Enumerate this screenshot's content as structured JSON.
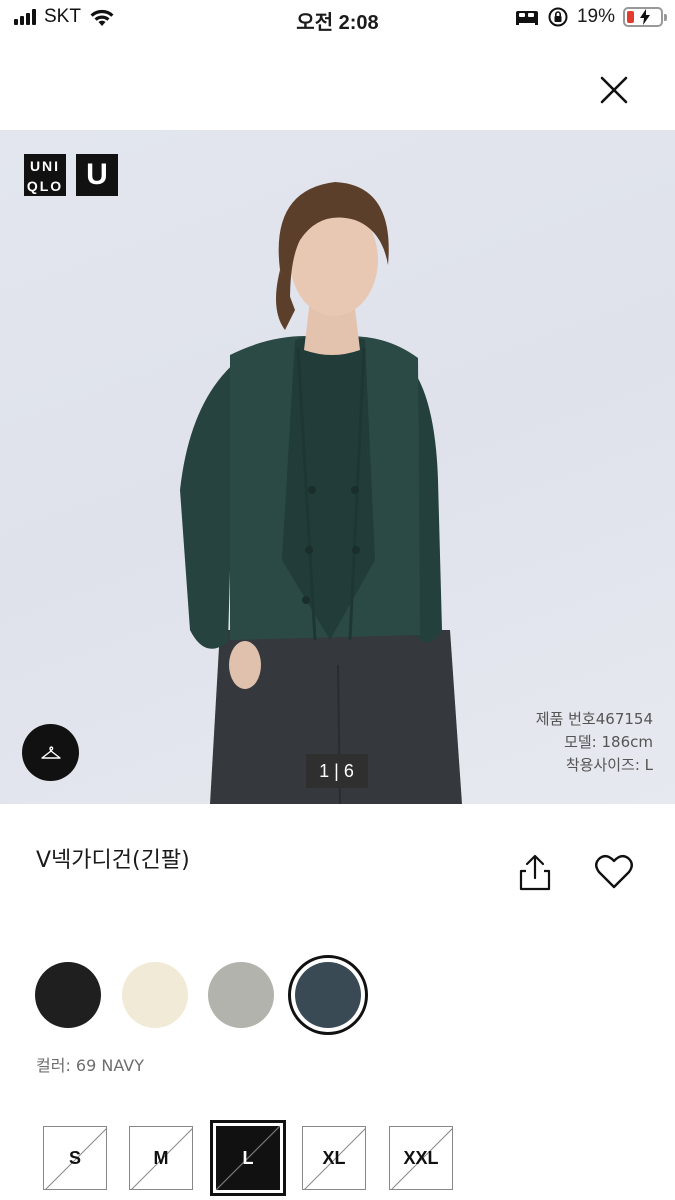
{
  "status_bar": {
    "carrier": "SKT",
    "time": "오전 2:08",
    "battery_percent": "19%"
  },
  "header": {
    "close_icon": "close-icon"
  },
  "hero": {
    "logo_left_lines": [
      "UNI",
      "QLO"
    ],
    "logo_right": "U",
    "counter_current": "1",
    "counter_total": "6",
    "product_number": "제품 번호467154",
    "model_height": "모델: 186cm",
    "worn_size": "착용사이즈: L",
    "hanger_icon": "hanger-icon"
  },
  "product": {
    "title": "V넥가디건(긴팔)",
    "share_icon": "share-icon",
    "favorite_icon": "heart-icon"
  },
  "colors": {
    "swatches": [
      {
        "name": "black",
        "hex": "#1f1f1f",
        "selected": false
      },
      {
        "name": "off-white",
        "hex": "#f1ead7",
        "selected": false
      },
      {
        "name": "gray",
        "hex": "#b3b3ad",
        "selected": false
      },
      {
        "name": "navy",
        "hex": "#3a4a55",
        "selected": true
      }
    ],
    "label": "컬러: 69 NAVY"
  },
  "sizes": {
    "options": [
      {
        "label": "S",
        "available": false,
        "selected": false
      },
      {
        "label": "M",
        "available": false,
        "selected": false
      },
      {
        "label": "L",
        "available": false,
        "selected": true
      },
      {
        "label": "XL",
        "available": false,
        "selected": false
      },
      {
        "label": "XXL",
        "available": false,
        "selected": false
      }
    ]
  }
}
